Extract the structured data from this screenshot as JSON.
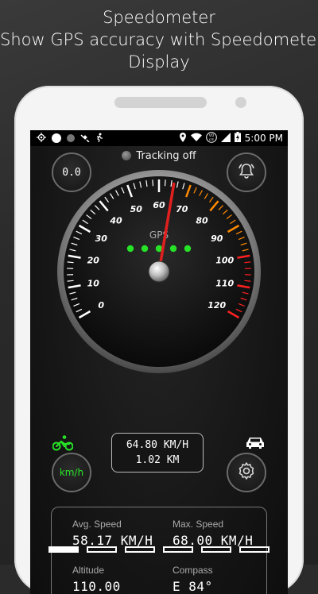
{
  "promo": {
    "line1": "Speedometer",
    "line2": "Show GPS accuracy with Speedometer",
    "line3": "Display"
  },
  "statusbar": {
    "time": "5:00 PM",
    "lte": "LTE",
    "icons": [
      "target-icon",
      "white-dot-icon",
      "gray-dot-icon",
      "satellite-icon",
      "walk-icon",
      "location-pin-icon",
      "wifi-icon",
      "volte-icon",
      "signal-icon",
      "battery-charging-icon"
    ]
  },
  "tracking": {
    "label": "Tracking off"
  },
  "buttons": {
    "trip_value": "0.0",
    "unit": "km/h"
  },
  "gauge": {
    "label": "GPS",
    "ticks": [
      "0",
      "10",
      "20",
      "30",
      "40",
      "50",
      "60",
      "70",
      "80",
      "90",
      "100",
      "110",
      "120"
    ],
    "needle_value": 64.8,
    "gps_dots": 5
  },
  "readout": {
    "speed": "64.80 KM/H",
    "distance": "1.02 KM"
  },
  "stats": {
    "avg_label": "Avg. Speed",
    "avg_value": "58.17 KM/H",
    "max_label": "Max. Speed",
    "max_value": "68.00 KM/H",
    "alt_label": "Altitude",
    "alt_value": "110.00",
    "compass_label": "Compass",
    "compass_value": "E 84°"
  },
  "pager": {
    "count": 6,
    "active": 0
  },
  "colors": {
    "needle": "#e0201e",
    "green": "#27e327",
    "orange": "#ff8a00",
    "red": "#ff2020"
  }
}
